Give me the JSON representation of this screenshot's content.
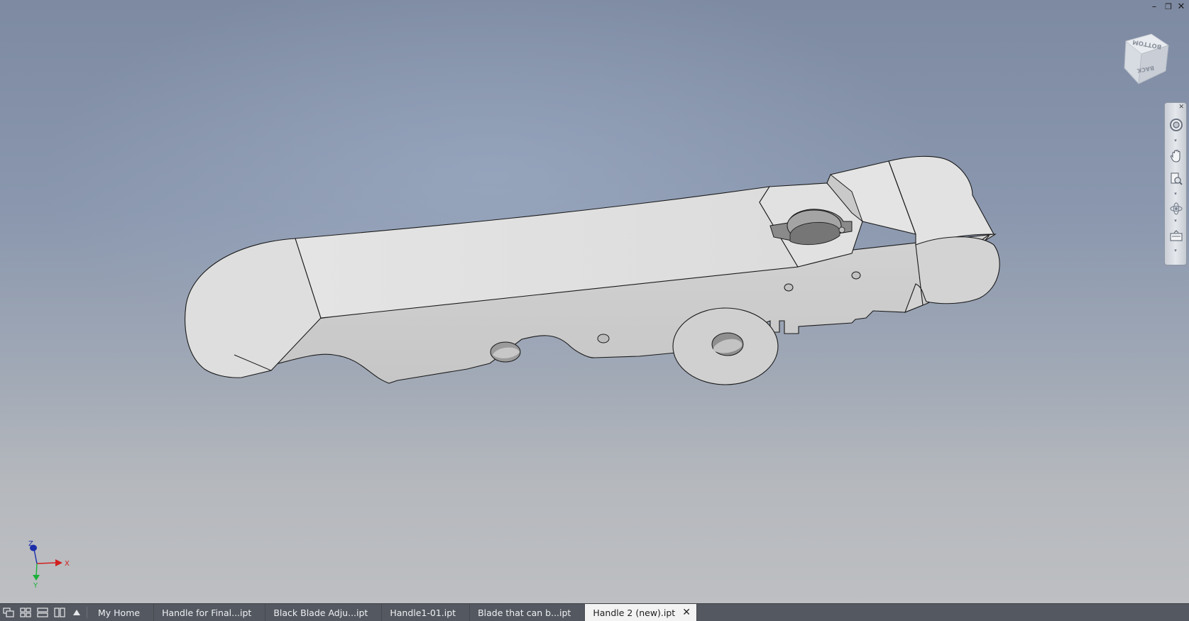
{
  "window_controls": {
    "minimize": "–",
    "restore": "❐",
    "close": "✕"
  },
  "viewcube": {
    "face_top": "BOTTOM",
    "face_side": "BACK"
  },
  "navbar": {
    "close": "✕",
    "tools": [
      "steering-wheel",
      "pan",
      "zoom",
      "orbit",
      "look-at"
    ]
  },
  "triad": {
    "x_label": "X",
    "y_label": "Y",
    "z_label": "Z",
    "x_color": "#d11f1f",
    "y_color": "#19b13a",
    "z_color": "#1c2ea8"
  },
  "tabs": [
    {
      "label": "My Home",
      "active": false
    },
    {
      "label": "Handle for Final...ipt",
      "active": false
    },
    {
      "label": "Black Blade Adju...ipt",
      "active": false
    },
    {
      "label": "Handle1-01.ipt",
      "active": false
    },
    {
      "label": "Blade that can b...ipt",
      "active": false
    },
    {
      "label": "Handle 2 (new).ipt",
      "active": true
    }
  ],
  "tab_close": "✕"
}
